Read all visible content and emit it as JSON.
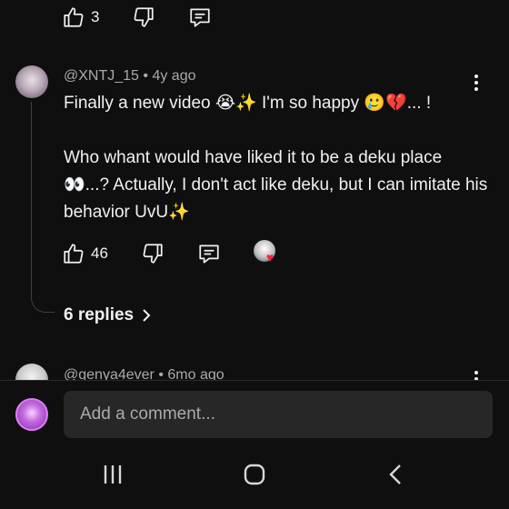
{
  "previous_actions": {
    "like_count": "3"
  },
  "comment": {
    "author": "@XNTJ_15",
    "separator": "•",
    "age": "4y ago",
    "text": "Finally a new video 😭✨ I'm so happy 🥲💔... !\n\nWho whant would have liked it to be a deku place 👀...? Actually, I don't act like deku, but I can imitate his behavior UvU✨",
    "like_count": "46",
    "creator_heart": "♥",
    "replies_label": "6 replies"
  },
  "next_comment": {
    "author": "@genya4ever",
    "separator": "•",
    "age": "6mo ago"
  },
  "composer": {
    "placeholder": "Add a comment..."
  },
  "colors": {
    "background": "#0f0f0f",
    "input_bg": "#272727",
    "secondary_text": "#aaaaaa",
    "heart": "#ff1f3d"
  },
  "icons": [
    "thumbs-up-icon",
    "thumbs-down-icon",
    "reply-icon",
    "more-vert-icon",
    "chevron-right-icon",
    "recents-icon",
    "home-icon",
    "back-icon"
  ]
}
